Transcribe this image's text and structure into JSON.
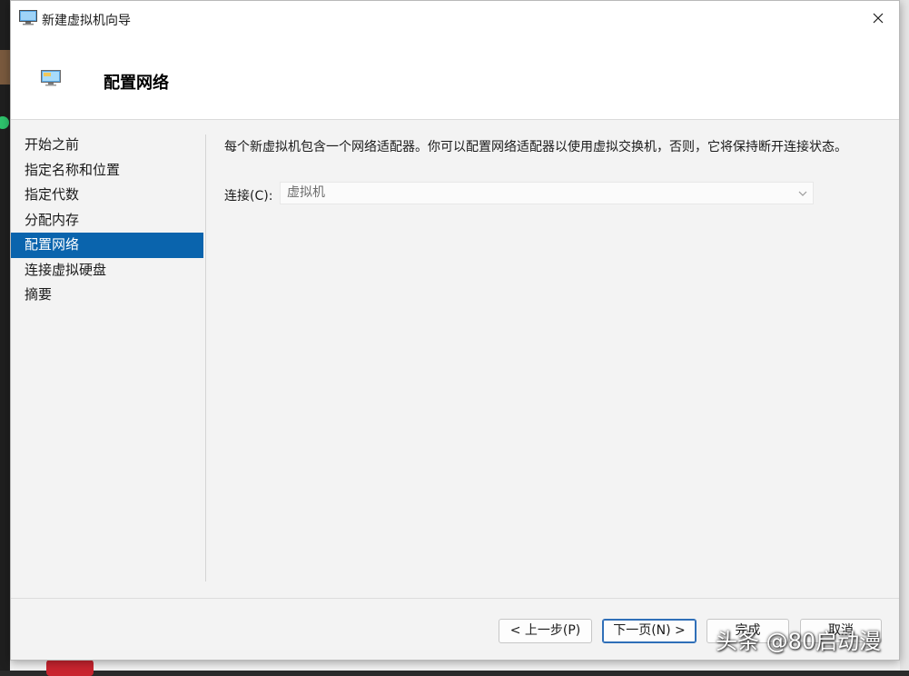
{
  "window": {
    "title": "新建虚拟机向导",
    "icon": "monitor-icon",
    "close_icon": "close-icon"
  },
  "header": {
    "title": "配置网络",
    "icon": "monitor-icon"
  },
  "nav": {
    "items": [
      {
        "label": "开始之前"
      },
      {
        "label": "指定名称和位置"
      },
      {
        "label": "指定代数"
      },
      {
        "label": "分配内存"
      },
      {
        "label": "配置网络",
        "active": true
      },
      {
        "label": "连接虚拟硬盘"
      },
      {
        "label": "摘要"
      }
    ]
  },
  "content": {
    "description": "每个新虚拟机包含一个网络适配器。你可以配置网络适配器以使用虚拟交换机，否则，它将保持断开连接状态。",
    "connection_label": "连接(C):",
    "connection_value": "虚拟机"
  },
  "buttons": {
    "prev": "< 上一步(P)",
    "next": "下一页(N) >",
    "finish": "完成",
    "cancel": "取消"
  },
  "watermark": "头条 @80启动漫",
  "colors": {
    "accent": "#0a64ad",
    "dialog_bg": "#f3f3f3",
    "header_bg": "#ffffff"
  }
}
